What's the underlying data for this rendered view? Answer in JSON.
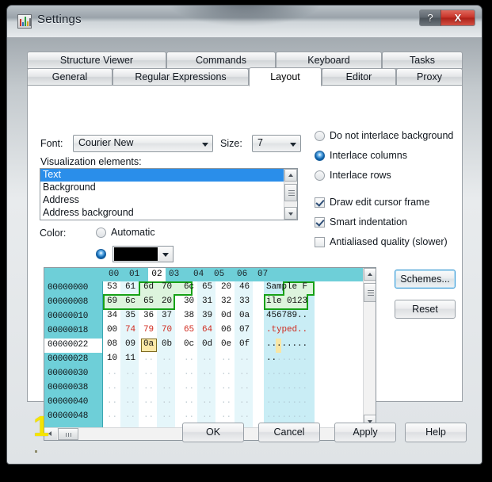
{
  "window": {
    "title": "Settings",
    "icon": "equalizer-icon",
    "help_button": "?",
    "close_button": "X"
  },
  "tabs": {
    "top_row": [
      {
        "label": "Structure Viewer",
        "active": false
      },
      {
        "label": "Commands",
        "active": false
      },
      {
        "label": "Keyboard",
        "active": false
      },
      {
        "label": "Tasks",
        "active": false
      }
    ],
    "bottom_row": [
      {
        "label": "General",
        "active": false
      },
      {
        "label": "Regular Expressions",
        "active": false
      },
      {
        "label": "Layout",
        "active": true
      },
      {
        "label": "Editor",
        "active": false
      },
      {
        "label": "Proxy",
        "active": false
      }
    ]
  },
  "layout_panel": {
    "font_label": "Font:",
    "font_value": "Courier New",
    "size_label": "Size:",
    "size_value": "7",
    "visualization_label": "Visualization elements:",
    "visualization_items": [
      {
        "label": "Text",
        "selected": true
      },
      {
        "label": "Background",
        "selected": false
      },
      {
        "label": "Address",
        "selected": false
      },
      {
        "label": "Address background",
        "selected": false
      }
    ],
    "color_label": "Color:",
    "color_automatic_label": "Automatic",
    "color_automatic_selected": false,
    "color_custom_selected": true,
    "color_custom_value": "#000000",
    "interlace_options": [
      {
        "label": "Do not interlace background",
        "selected": false
      },
      {
        "label": "Interlace columns",
        "selected": true
      },
      {
        "label": "Interlace rows",
        "selected": false
      }
    ],
    "checkboxes": [
      {
        "label": "Draw edit cursor frame",
        "checked": true
      },
      {
        "label": "Smart indentation",
        "checked": true
      },
      {
        "label": "Antialiased quality (slower)",
        "checked": false
      }
    ],
    "schemes_button": "Schemes...",
    "reset_button": "Reset"
  },
  "hex_preview": {
    "column_headers": [
      "00",
      "01",
      "02",
      "03",
      "04",
      "05",
      "06",
      "07"
    ],
    "highlighted_column": "02",
    "current_address": "00000022",
    "cursor_cell": "0a",
    "rows": [
      {
        "address": "00000000",
        "bytes": [
          "53",
          "61",
          "6d",
          "70",
          "6c",
          "65",
          "20",
          "46"
        ],
        "ascii": "Sample F",
        "red": [],
        "dim": false
      },
      {
        "address": "00000008",
        "bytes": [
          "69",
          "6c",
          "65",
          "20",
          "30",
          "31",
          "32",
          "33"
        ],
        "ascii": "ile 0123",
        "red": [],
        "dim": false
      },
      {
        "address": "00000010",
        "bytes": [
          "34",
          "35",
          "36",
          "37",
          "38",
          "39",
          "0d",
          "0a"
        ],
        "ascii": "456789..",
        "red": [],
        "dim": false
      },
      {
        "address": "00000018",
        "bytes": [
          "00",
          "74",
          "79",
          "70",
          "65",
          "64",
          "06",
          "07"
        ],
        "ascii": ".typed..",
        "red": [
          1,
          2,
          3,
          4,
          5
        ],
        "ascii_red": [
          1,
          2,
          3,
          4,
          5
        ],
        "dim": false
      },
      {
        "address": "00000022",
        "bytes": [
          "08",
          "09",
          "0a",
          "0b",
          "0c",
          "0d",
          "0e",
          "0f"
        ],
        "ascii": "........",
        "red": [],
        "dim": false
      },
      {
        "address": "00000028",
        "bytes": [
          "10",
          "11",
          "..",
          "..",
          "..",
          "..",
          "..",
          ".."
        ],
        "ascii": "..______",
        "red": [],
        "dim": "partial"
      },
      {
        "address": "00000030",
        "bytes": [
          "..",
          "..",
          "..",
          "..",
          "..",
          "..",
          "..",
          ".."
        ],
        "ascii": "........",
        "red": [],
        "dim": true
      },
      {
        "address": "00000038",
        "bytes": [
          "..",
          "..",
          "..",
          "..",
          "..",
          "..",
          "..",
          ".."
        ],
        "ascii": "........",
        "red": [],
        "dim": true
      },
      {
        "address": "00000040",
        "bytes": [
          "..",
          "..",
          "..",
          "..",
          "..",
          "..",
          "..",
          ".."
        ],
        "ascii": "........",
        "red": [],
        "dim": true
      },
      {
        "address": "00000048",
        "bytes": [
          "..",
          "..",
          "..",
          "..",
          "..",
          "..",
          "..",
          ".."
        ],
        "ascii": "........",
        "red": [],
        "dim": true
      }
    ],
    "selection_note": "Sample File 0123 selected with green outline"
  },
  "footer": {
    "buttons": [
      "OK",
      "Cancel",
      "Apply",
      "Help"
    ]
  },
  "annotation": {
    "marker": "1"
  },
  "colors": {
    "teal_header": "#6ecfd8",
    "ascii_background": "#c9edf5",
    "zebra_column": "#e5f6fa",
    "selection_green_fill": "#ddf4dd",
    "selection_green_line": "#17a117",
    "cursor_yellow": "#fce9a8",
    "red_text": "#d02a1e",
    "list_selection_blue": "#2a8eea",
    "annotation_yellow": "#f5e400",
    "titlebar_close_red": "#c8352a"
  }
}
